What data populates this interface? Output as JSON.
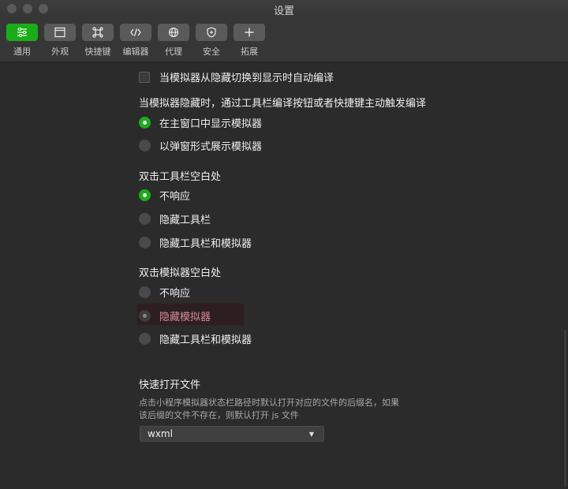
{
  "window": {
    "title": "设置"
  },
  "toolbar": {
    "items": [
      {
        "label": "通用",
        "icon": "sliders-icon",
        "active": true
      },
      {
        "label": "外观",
        "icon": "window-icon",
        "active": false
      },
      {
        "label": "快捷键",
        "icon": "command-icon",
        "active": false
      },
      {
        "label": "编辑器",
        "icon": "code-icon",
        "active": false
      },
      {
        "label": "代理",
        "icon": "globe-icon",
        "active": false
      },
      {
        "label": "安全",
        "icon": "shield-icon",
        "active": false
      },
      {
        "label": "拓展",
        "icon": "plus-icon",
        "active": false
      }
    ]
  },
  "settings": {
    "auto_compile": {
      "label": "当模拟器从隐藏切换到显示时自动编译",
      "checked": false
    },
    "hidden_compile_note": "当模拟器隐藏时，通过工具栏编译按钮或者快捷键主动触发编译",
    "simulator_display": {
      "options": [
        "在主窗口中显示模拟器",
        "以弹窗形式展示模拟器"
      ],
      "selected": 0
    },
    "toolbar_dblclick": {
      "title": "双击工具栏空白处",
      "options": [
        "不响应",
        "隐藏工具栏",
        "隐藏工具栏和模拟器"
      ],
      "selected": 0
    },
    "simulator_dblclick": {
      "title": "双击模拟器空白处",
      "options": [
        "不响应",
        "隐藏模拟器",
        "隐藏工具栏和模拟器"
      ],
      "selected": 1
    },
    "quick_open": {
      "title": "快速打开文件",
      "description": "点击小程序模拟器状态栏路径时默认打开对应的文件的后缀名，如果该后缀的文件不存在，则默认打开 js 文件",
      "value": "wxml"
    }
  },
  "colors": {
    "accent": "#1aad19",
    "highlight_text": "#d58b96",
    "background": "#2b2b2b"
  }
}
